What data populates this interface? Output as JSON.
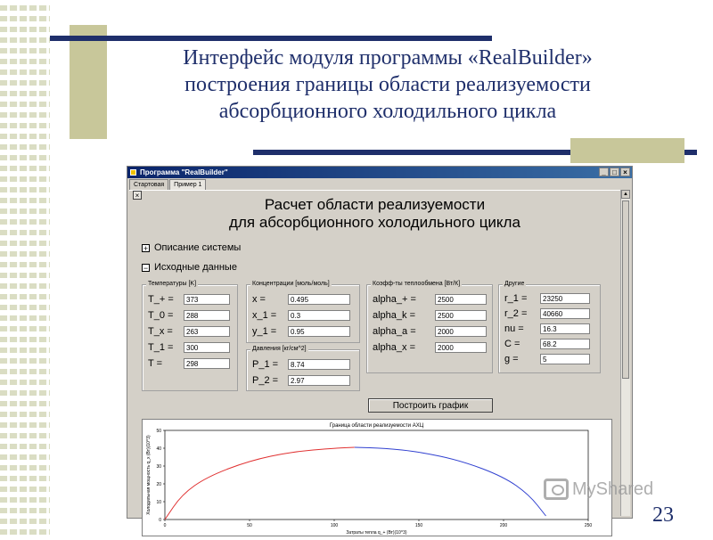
{
  "slide": {
    "title_lines": [
      "Интерфейс модуля программы «RealBuilder»",
      "построения границы области реализуемости",
      "абсорбционного холодильного цикла"
    ],
    "number": "23",
    "watermark": "MyShared"
  },
  "window": {
    "title": "Программа \"RealBuilder\"",
    "buttons": [
      "_",
      "□",
      "×"
    ],
    "tabs": [
      "Стартовая",
      "Пример 1"
    ],
    "active_tab": 1,
    "close_label": "×",
    "heading_line1": "Расчет области реализуемости",
    "heading_line2": "для абсорбционного холодильного цикла",
    "section_system": {
      "icon": "+",
      "label": "Описание системы"
    },
    "section_input": {
      "icon": "−",
      "label": "Исходные данные"
    },
    "groups": {
      "temps": {
        "title": "Температуры [K]",
        "rows": [
          {
            "label": "T_+ =",
            "value": "373"
          },
          {
            "label": "T_0 =",
            "value": "288"
          },
          {
            "label": "T_x =",
            "value": "263"
          },
          {
            "label": "T_1 =",
            "value": "300"
          },
          {
            "label": "T    =",
            "value": "298"
          }
        ]
      },
      "conc": {
        "title": "Концентрации [моль/моль]",
        "rows": [
          {
            "label": "x    =",
            "value": "0.495"
          },
          {
            "label": "x_1 =",
            "value": "0.3"
          },
          {
            "label": "y_1 =",
            "value": "0.95"
          }
        ]
      },
      "pressure": {
        "title": "Давления [кг/см^2]",
        "rows": [
          {
            "label": "P_1 =",
            "value": "8.74"
          },
          {
            "label": "P_2 =",
            "value": "2.97"
          }
        ]
      },
      "heat": {
        "title": "Коэфф-ты теплообмена [Вт/К]",
        "rows": [
          {
            "label": "alpha_+ =",
            "value": "2500"
          },
          {
            "label": "alpha_k =",
            "value": "2500"
          },
          {
            "label": "alpha_a =",
            "value": "2000"
          },
          {
            "label": "alpha_x =",
            "value": "2000"
          }
        ]
      },
      "other": {
        "title": "Другие",
        "rows": [
          {
            "label": "r_1 =",
            "value": "23250"
          },
          {
            "label": "r_2 =",
            "value": "40660"
          },
          {
            "label": "nu   =",
            "value": "16.3"
          },
          {
            "label": "C     =",
            "value": "68.2"
          },
          {
            "label": "g     =",
            "value": "5"
          }
        ]
      }
    },
    "plot_button": "Построить график"
  },
  "chart_data": {
    "type": "line",
    "title": "Граница области реализуемости АХЦ",
    "xlabel": "Затраты тепла q_+ (Вт)(10^3)",
    "ylabel": "Холодильная мощность q_x (Вт)(10^3)",
    "xlim": [
      0,
      250
    ],
    "ylim": [
      0,
      50
    ],
    "x_ticks": [
      0,
      50,
      100,
      150,
      200,
      250
    ],
    "y_ticks": [
      0,
      10,
      20,
      30,
      40,
      50
    ],
    "grid": false,
    "series": [
      {
        "color": "#e03030",
        "x": [
          0,
          10,
          25,
          50,
          75,
          100,
          112
        ],
        "y": [
          0,
          14,
          24,
          33,
          38,
          40,
          40.5
        ]
      },
      {
        "color": "#3040d0",
        "x": [
          112,
          130,
          150,
          175,
          200,
          215,
          225
        ],
        "y": [
          40.5,
          40,
          38,
          33,
          24,
          14,
          2
        ]
      }
    ]
  }
}
